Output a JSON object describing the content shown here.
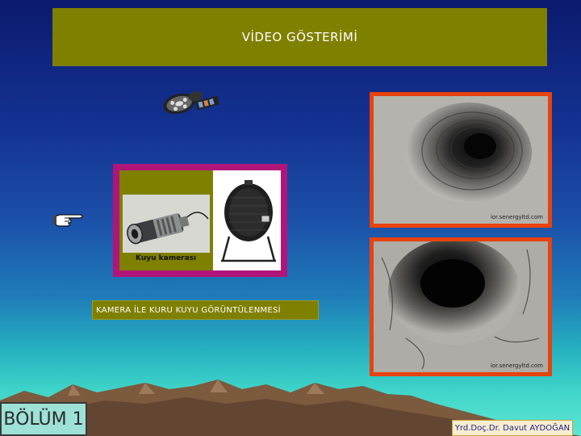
{
  "slide": {
    "title": "VİDEO GÖSTERİMİ",
    "camera_caption": "Kuyu kamerası",
    "imaging_caption": "KAMERA İLE KURU KUYU GÖRÜNTÜLENMESİ",
    "watermark_top": "ior.senergyltd.com",
    "watermark_bottom": "ior.senergyltd.com",
    "section_label": "BÖLÜM 1",
    "author": "Yrd.Doç.Dr. Davut AYDOĞAN"
  },
  "colors": {
    "title_bg": "#7f7f00",
    "camera_frame": "#b0157a",
    "well_frame": "#e8420f"
  },
  "icons": [
    "film-reel-icon",
    "pointing-hand-icon"
  ]
}
